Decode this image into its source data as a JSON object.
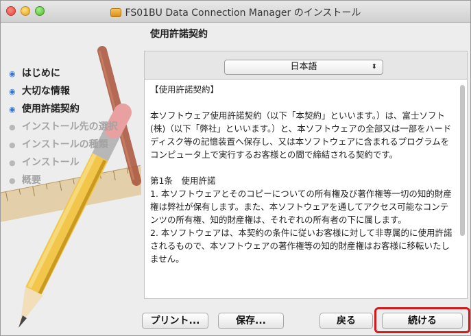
{
  "window": {
    "title": "FS01BU Data Connection Manager のインストール"
  },
  "sidebar": {
    "steps": [
      {
        "label": "はじめに",
        "state": "done"
      },
      {
        "label": "大切な情報",
        "state": "done"
      },
      {
        "label": "使用許諾契約",
        "state": "current"
      },
      {
        "label": "インストール先の選択",
        "state": "pending"
      },
      {
        "label": "インストールの種類",
        "state": "pending"
      },
      {
        "label": "インストール",
        "state": "pending"
      },
      {
        "label": "概要",
        "state": "pending"
      }
    ]
  },
  "content": {
    "section_title": "使用許諾契約",
    "language_select": "日本語",
    "license_paragraphs": [
      "【使用許諾契約】",
      "",
      "本ソフトウェア使用許諾契約（以下「本契約」といいます。）は、富士ソフト(株)（以下「弊社」といいます。）と、本ソフトウェアの全部又は一部をハードディスク等の記憶装置へ保存し、又は本ソフトウェアに含まれるプログラムをコンピュータ上で実行するお客様との間で締結される契約です。",
      "",
      "第1条　使用許諾",
      "1. 本ソフトウェアとそのコピーについての所有権及び著作権等一切の知的財産権は弊社が保有します。また、本ソフトウェアを通してアクセス可能なコンテンツの所有権、知的財産権は、それぞれの所有者の下に属します。",
      "2. 本ソフトウェアは、本契約の条件に従いお客様に対して非専属的に使用許諾されるもので、本ソフトウェアの著作権等の知的財産権はお客様に移転いたしません。"
    ]
  },
  "buttons": {
    "print": "プリント...",
    "save": "保存...",
    "back": "戻る",
    "continue": "続ける"
  },
  "colors": {
    "current_step_dot": "#2f72d8",
    "highlight_border": "#d01c1c"
  },
  "icons": {
    "title_icon": "package-icon",
    "select_arrows": "up-down-arrows-icon"
  }
}
